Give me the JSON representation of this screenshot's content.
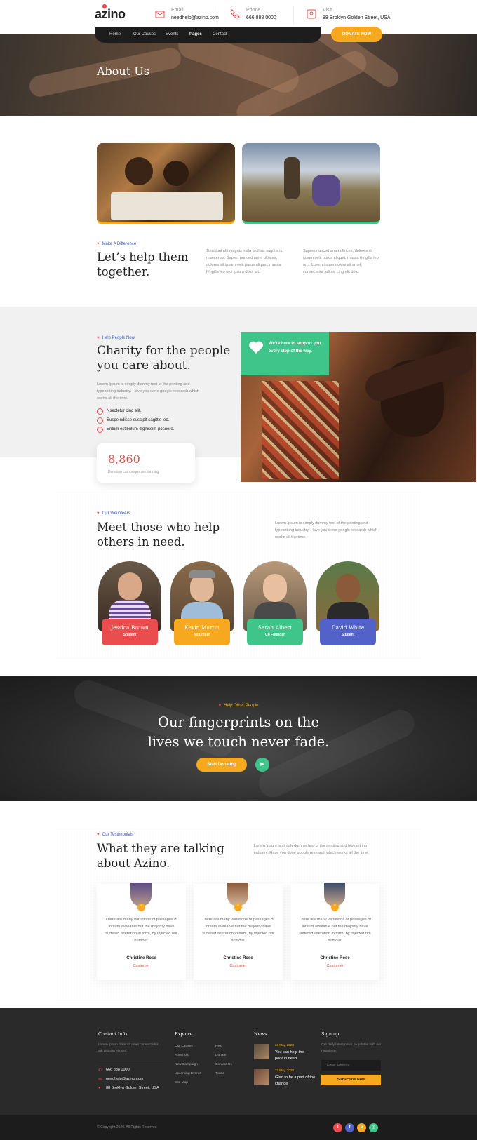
{
  "header": {
    "logo": "azino",
    "contacts": [
      {
        "label": "Email",
        "value": "needhelp@azino.com",
        "icon": "mail-icon"
      },
      {
        "label": "Phone",
        "value": "666 888 0000",
        "icon": "phone-icon"
      },
      {
        "label": "Visit",
        "value": "88 Broklyn Golden Street, USA",
        "icon": "location-icon"
      }
    ],
    "nav": [
      "Home",
      "Our Causes",
      "Events",
      "Pages",
      "Contact"
    ],
    "active_nav": "Pages",
    "donate_label": "DONATE NOW"
  },
  "hero": {
    "title": "About Us"
  },
  "about": {
    "eyebrow": "Make A Difference",
    "heading": "Let’s help them together.",
    "text1": "Tincidunt elit magnis nulla facilisis sagittis is maecenas. Sapien nunced amet ultrices, dolores sit ipsum velit purus aliquet, massa fringilla leo orci ipsum dolor sit.",
    "text2": "Sapien nunced amet ultrices, dolores sit ipsum velit purus aliquet, massa fringilla leo orci. Lorem ipsum dolors sit amet, consectetur adipisi cing elit dolo."
  },
  "charity": {
    "eyebrow": "Help People Now",
    "heading": "Charity for the people you care about.",
    "text": "Lorem Ipsum is simply dummy text of the printing and typesetting industry. Have you done google research which works all the time.",
    "checks": [
      "Nsectetur cing elit.",
      "Suspe ndisse suscipit sagittis leo.",
      "Entum estibulum dignissim posuere."
    ],
    "stat_number": "8,860",
    "stat_caption": "Donation campaigns are running",
    "support_text": "We’re here to support you every step of the way."
  },
  "volunteers": {
    "eyebrow": "Our Volunteers",
    "heading": "Meet those who help others in need.",
    "text": "Lorem Ipsum is simply dummy text of the printing and typesetting industry. Have you done google research which works all the time.",
    "people": [
      {
        "name": "Jessica Brown",
        "role": "Student",
        "color": "#e94d4d"
      },
      {
        "name": "Kevin Martin",
        "role": "Volunteer",
        "color": "#f6a91e"
      },
      {
        "name": "Sarah Albert",
        "role": "Co Founder",
        "color": "#3fc58a"
      },
      {
        "name": "David White",
        "role": "Student",
        "color": "#5262c8"
      }
    ]
  },
  "banner": {
    "eyebrow": "Help Other People",
    "heading_line1": "Our fingerprints on the",
    "heading_line2": "lives we touch never fade.",
    "cta": "Start Donating"
  },
  "testimonials": {
    "eyebrow": "Our Testimonials",
    "heading": "What they are talking about Azino.",
    "text": "Lorem Ipsum is simply dummy text of the printing and typesetting industry. Have you done google research which works all the time.",
    "items": [
      {
        "quote": "There are many variations of passages of lorsum available but the majority have suffered alteration in form, by injected not humour.",
        "name": "Christine Rose",
        "role": "Customer"
      },
      {
        "quote": "There are many variations of passages of lorsum available but the majority have suffered alteration in form, by injected not humour.",
        "name": "Christine Rose",
        "role": "Customer"
      },
      {
        "quote": "There are many variations of passages of lorsum available but the majority have suffered alteration in form, by injected not humour.",
        "name": "Christine Rose",
        "role": "Customer"
      }
    ]
  },
  "footer": {
    "contact_title": "Contact Info",
    "contact_text": "Lorem ipsum dolor sit amet consect etur adi pisicing elit sed.",
    "phone": "666 888 0000",
    "email": "needhelp@azino.com",
    "address": "88 Broklyn Golden Street, USA",
    "explore_title": "Explore",
    "explore_col1": [
      "Our Causes",
      "About Us",
      "New Campaign",
      "Upcoming Events",
      "Site Map"
    ],
    "explore_col2": [
      "Help",
      "Donate",
      "Contact Us",
      "Terms"
    ],
    "news_title": "News",
    "news": [
      {
        "date": "22 May, 2020",
        "title": "You can help the poor in need"
      },
      {
        "date": "22 May, 2020",
        "title": "Glad to be a part of the change"
      }
    ],
    "signup_title": "Sign up",
    "signup_text": "Get daily latest news & updates with our newsletter",
    "email_placeholder": "Email Address",
    "subscribe_label": "Subscribe Now",
    "copyright": "© Copyright 2020. All Rights Reserved",
    "social": [
      "twitter-icon",
      "facebook-icon",
      "pinterest-icon",
      "instagram-icon"
    ]
  }
}
